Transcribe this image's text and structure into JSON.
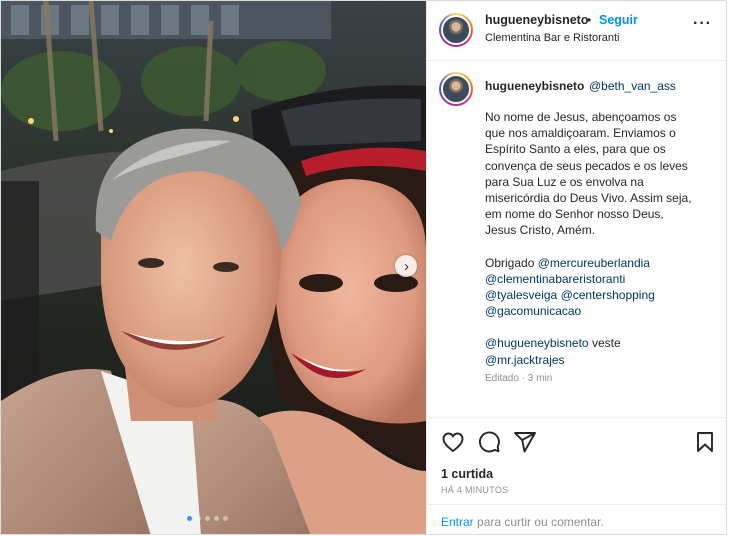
{
  "header": {
    "username": "hugueneybisneto",
    "separator": "•",
    "follow_label": "Seguir",
    "location": "Clementina Bar e Ristoranti",
    "more_icon": "more-options-icon"
  },
  "caption": {
    "username": "hugueneybisneto",
    "mention": "@beth_van_ass",
    "body_lines": [
      "No nome de Jesus, abençoamos os",
      "que nos amaldiçoaram. Enviamos o",
      "Espírito Santo a eles, para que os",
      "convença de seus pecados e os leves",
      "para Sua Luz e os envolva na",
      "misericórdia do Deus Vivo. Assim seja,",
      "em nome do Senhor nosso Deus,",
      "Jesus Cristo, Amém."
    ],
    "thanks_prefix": "Obrigado",
    "thanks_mentions": [
      "@mercureuberlandia",
      "@clementinabareristoranti",
      "@tyalesveiga",
      "@centershopping",
      "@gacomunicacao"
    ],
    "wear_mention": "@hugueneybisneto",
    "wear_word": "veste",
    "brand_mention": "@mr.jacktrajes",
    "edited": "Editado · 3 min"
  },
  "actions": {
    "like_icon": "heart-icon",
    "comment_icon": "comment-icon",
    "share_icon": "share-icon",
    "save_icon": "bookmark-icon"
  },
  "likes": "1 curtida",
  "time_ago": "HÁ 4 MINUTOS",
  "comment_bar": {
    "login_label": "Entrar",
    "suffix": "para curtir ou comentar."
  },
  "carousel": {
    "next_icon": "chevron-right-icon",
    "slide_count": 5,
    "active_index": 0
  },
  "colors": {
    "link": "#00376b",
    "accent": "#0095f6",
    "muted": "#8e8e8e",
    "dot_active": "#3897f0"
  }
}
